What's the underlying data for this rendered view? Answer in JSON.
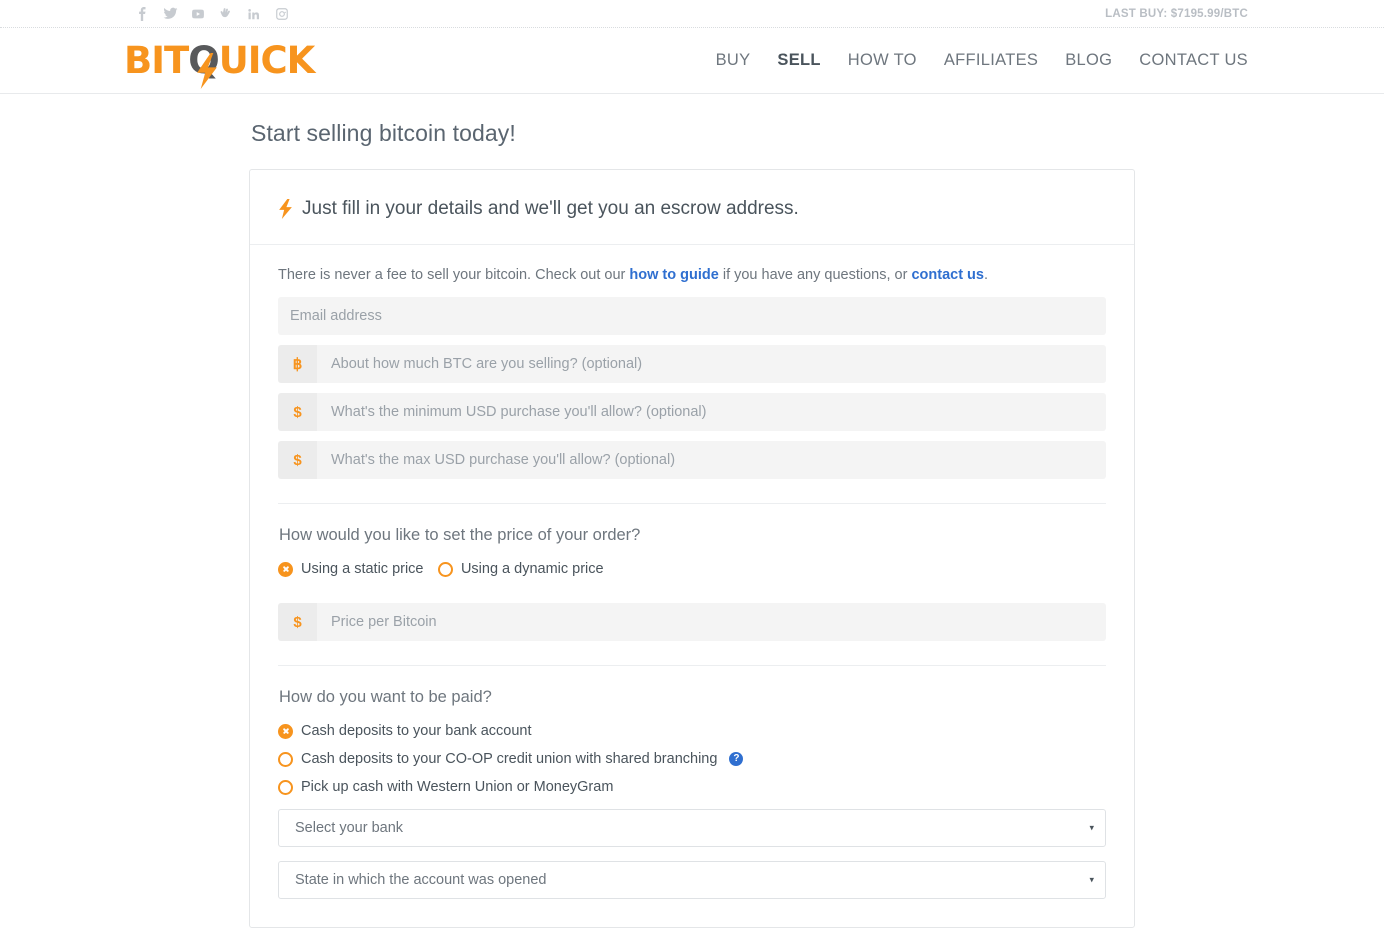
{
  "topbar": {
    "social": [
      {
        "name": "facebook-icon",
        "label": "Facebook"
      },
      {
        "name": "twitter-icon",
        "label": "Twitter"
      },
      {
        "name": "youtube-icon",
        "label": "YouTube"
      },
      {
        "name": "bitcointalk-icon",
        "label": "Bitcointalk"
      },
      {
        "name": "linkedin-icon",
        "label": "LinkedIn"
      },
      {
        "name": "instagram-icon",
        "label": "Instagram"
      }
    ],
    "last_buy": "LAST BUY: $7195.99/BTC"
  },
  "header": {
    "logo": {
      "part1": "BIT",
      "part2": "Q",
      "part3": "UICK"
    },
    "nav": [
      {
        "label": "BUY",
        "active": false
      },
      {
        "label": "SELL",
        "active": true
      },
      {
        "label": "HOW TO",
        "active": false
      },
      {
        "label": "AFFILIATES",
        "active": false
      },
      {
        "label": "BLOG",
        "active": false
      },
      {
        "label": "CONTACT US",
        "active": false
      }
    ]
  },
  "page": {
    "title": "Start selling bitcoin today!"
  },
  "card": {
    "header_title": "Just fill in your details and we'll get you an escrow address.",
    "lead": {
      "text_before": "There is never a fee to sell your bitcoin. Check out our ",
      "link1": "how to guide",
      "text_middle": " if you have any questions, or ",
      "link2": "contact us",
      "text_after": "."
    },
    "fields": [
      {
        "name": "email-field",
        "addon": "",
        "placeholder": "Email address",
        "value": ""
      },
      {
        "name": "btc-amount-field",
        "addon": "฿",
        "placeholder": "About how much BTC are you selling? (optional)",
        "value": ""
      },
      {
        "name": "min-usd-field",
        "addon": "$",
        "placeholder": "What's the minimum USD purchase you'll allow? (optional)",
        "value": ""
      },
      {
        "name": "max-usd-field",
        "addon": "$",
        "placeholder": "What's the max USD purchase you'll allow? (optional)",
        "value": ""
      }
    ],
    "price_section": {
      "question": "How would you like to set the price of your order?",
      "options": [
        {
          "label": "Using a static price",
          "checked": true
        },
        {
          "label": "Using a dynamic price",
          "checked": false
        }
      ],
      "price_field": {
        "addon": "$",
        "placeholder": "Price per Bitcoin",
        "value": ""
      }
    },
    "payment_section": {
      "question": "How do you want to be paid?",
      "options": [
        {
          "label": "Cash deposits to your bank account",
          "checked": true,
          "help": false
        },
        {
          "label": "Cash deposits to your CO-OP credit union with shared branching",
          "checked": false,
          "help": true
        },
        {
          "label": "Pick up cash with Western Union or MoneyGram",
          "checked": false,
          "help": false
        }
      ],
      "help_glyph": "?",
      "selects": [
        {
          "name": "bank-select",
          "value": "Select your bank",
          "caret": "▾"
        },
        {
          "name": "state-select",
          "value": "State in which the account was opened",
          "caret": "▾"
        }
      ]
    }
  },
  "colors": {
    "brand_orange": "#f7941e",
    "link_blue": "#2f6fd0",
    "text_gray": "#4a545c"
  }
}
